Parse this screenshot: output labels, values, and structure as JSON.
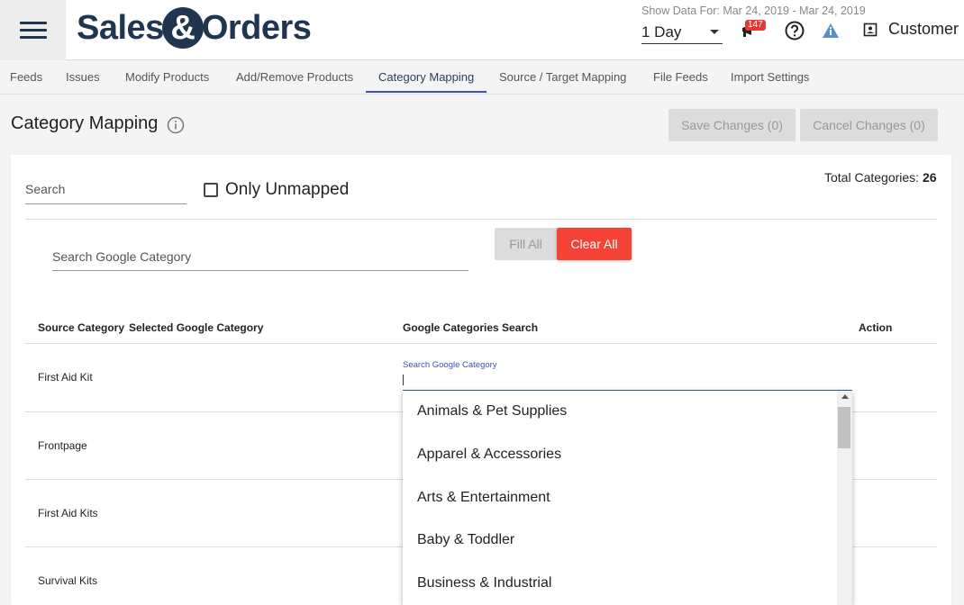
{
  "header": {
    "brand_left": "Sales",
    "brand_amp": "&",
    "brand_right": "Orders",
    "date_range": "Show Data For: Mar 24, 2019 - Mar 24, 2019",
    "period_value": "1 Day",
    "notification_count": "147",
    "user_label": "Customer"
  },
  "tabs": [
    {
      "label": "Feeds"
    },
    {
      "label": "Issues"
    },
    {
      "label": "Modify Products"
    },
    {
      "label": "Add/Remove Products"
    },
    {
      "label": "Category Mapping"
    },
    {
      "label": "Source / Target Mapping"
    },
    {
      "label": "File Feeds"
    },
    {
      "label": "Import Settings"
    }
  ],
  "active_tab": "Category Mapping",
  "page": {
    "title": "Category Mapping",
    "save_label": "Save Changes (0)",
    "cancel_label": "Cancel Changes (0)"
  },
  "filters": {
    "search_placeholder": "Search",
    "only_unmapped_label": "Only Unmapped",
    "total_label": "Total Categories: ",
    "total_value": "26",
    "google_search_placeholder": "Search Google Category",
    "fill_all_label": "Fill All",
    "clear_all_label": "Clear All"
  },
  "table": {
    "headers": [
      "Source Category",
      "Selected Google Category",
      "Google Categories Search",
      "Action"
    ],
    "rows": [
      {
        "source": "First Aid Kit"
      },
      {
        "source": "Frontpage"
      },
      {
        "source": "First Aid Kits"
      },
      {
        "source": "Survival Kits"
      }
    ],
    "google_field_label": "Search Google Category"
  },
  "dropdown": {
    "options": [
      "Animals & Pet Supplies",
      "Apparel & Accessories",
      "Arts & Entertainment",
      "Baby & Toddler",
      "Business & Industrial"
    ]
  },
  "colors": {
    "brand": "#1f3550",
    "accent": "#3f51b5",
    "danger": "#f44336",
    "info": "#5b8fc9"
  }
}
